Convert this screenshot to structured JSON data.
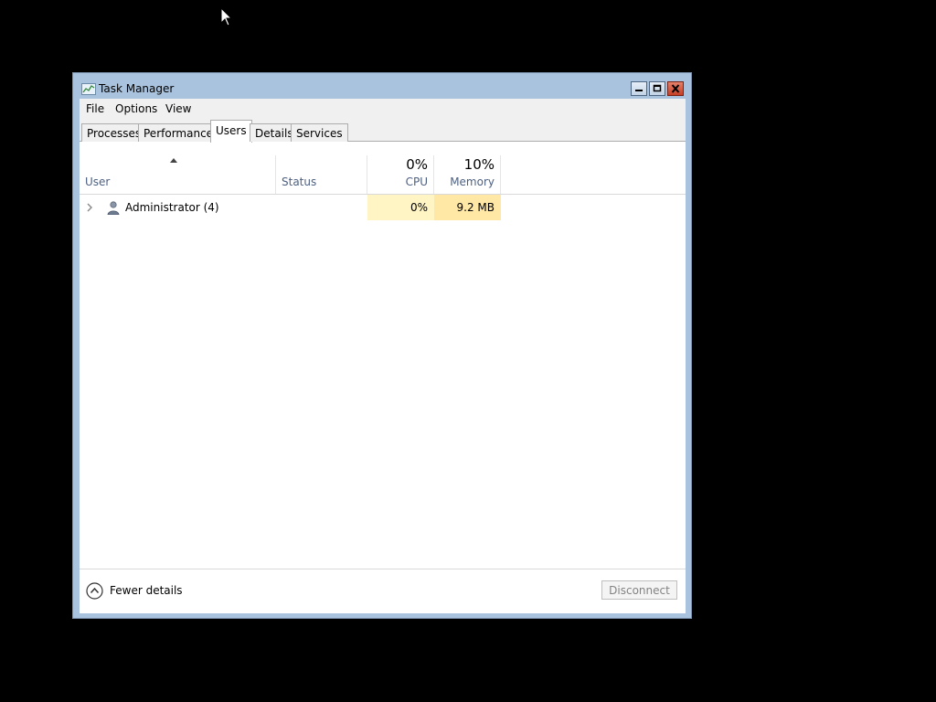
{
  "window": {
    "title": "Task Manager",
    "icon": "task-manager-icon",
    "controls": [
      "minimize-icon",
      "maximize-icon",
      "close-icon"
    ]
  },
  "menu": {
    "file": "File",
    "options": "Options",
    "view": "View"
  },
  "tabs": [
    {
      "label": "Processes",
      "active": false
    },
    {
      "label": "Performance",
      "active": false
    },
    {
      "label": "Users",
      "active": true
    },
    {
      "label": "Details",
      "active": false
    },
    {
      "label": "Services",
      "active": false
    }
  ],
  "columns": {
    "user": "User",
    "status": "Status",
    "cpu_pct": "0%",
    "cpu": "CPU",
    "memory_pct": "10%",
    "memory": "Memory"
  },
  "rows": [
    {
      "user": "Administrator (4)",
      "status": "",
      "cpu": "0%",
      "memory": "9.2 MB",
      "icon": "user-icon"
    }
  ],
  "footer": {
    "fewer_details": "Fewer details",
    "disconnect": "Disconnect"
  },
  "colors": {
    "cpu_heat": "#fff4c4",
    "memory_heat": "#ffe8a6",
    "title_bar": "#a9c3de"
  }
}
